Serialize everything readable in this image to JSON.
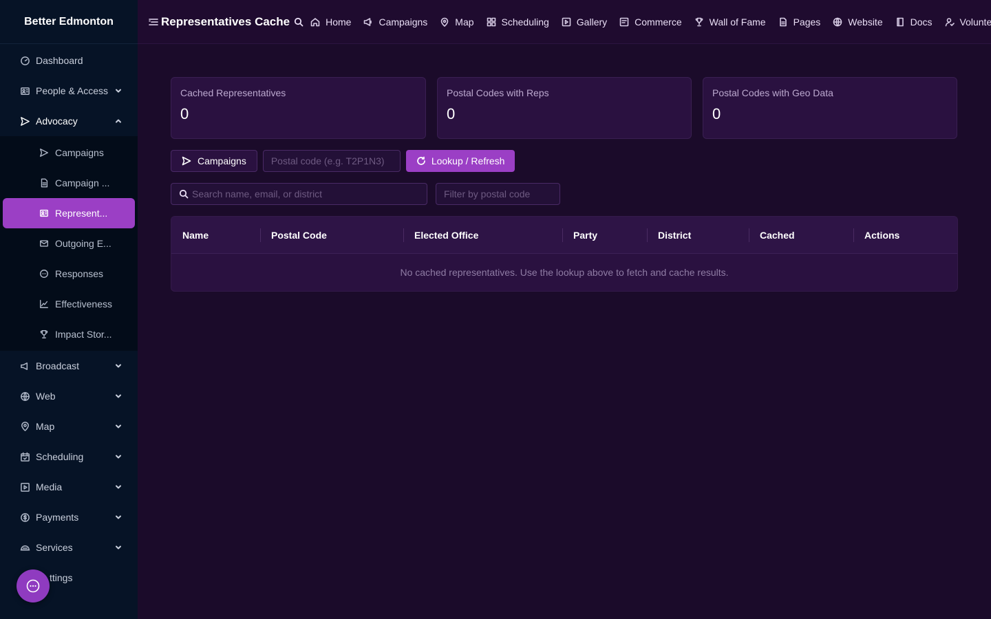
{
  "sidebar": {
    "brand": "Better Edmonton",
    "items_top": [
      {
        "label": "Dashboard",
        "icon": "dashboard-icon"
      },
      {
        "label": "People & Access",
        "icon": "people-icon"
      },
      {
        "label": "Advocacy",
        "icon": "send-icon"
      }
    ],
    "advocacy_sub": [
      {
        "label": "Campaigns",
        "icon": "send-icon"
      },
      {
        "label": "Campaign ...",
        "icon": "document-icon"
      },
      {
        "label": "Represent...",
        "icon": "id-card-icon"
      },
      {
        "label": "Outgoing E...",
        "icon": "mail-icon"
      },
      {
        "label": "Responses",
        "icon": "chat-icon"
      },
      {
        "label": "Effectiveness",
        "icon": "chart-icon"
      },
      {
        "label": "Impact Stor...",
        "icon": "trophy-icon"
      }
    ],
    "items_bottom": [
      {
        "label": "Broadcast",
        "icon": "megaphone-icon"
      },
      {
        "label": "Web",
        "icon": "globe-icon"
      },
      {
        "label": "Map",
        "icon": "map-pin-icon"
      },
      {
        "label": "Scheduling",
        "icon": "calendar-icon"
      },
      {
        "label": "Media",
        "icon": "play-icon"
      },
      {
        "label": "Payments",
        "icon": "dollar-icon"
      },
      {
        "label": "Services",
        "icon": "services-icon"
      },
      {
        "label": "ttings",
        "icon": "settings-icon"
      }
    ]
  },
  "topbar": {
    "title": "Representatives Cache",
    "links": [
      {
        "label": "Home",
        "icon": "home-icon"
      },
      {
        "label": "Campaigns",
        "icon": "megaphone-icon"
      },
      {
        "label": "Map",
        "icon": "map-pin-icon"
      },
      {
        "label": "Scheduling",
        "icon": "grid-icon"
      },
      {
        "label": "Gallery",
        "icon": "play-icon"
      },
      {
        "label": "Commerce",
        "icon": "commerce-icon"
      },
      {
        "label": "Wall of Fame",
        "icon": "trophy-icon"
      },
      {
        "label": "Pages",
        "icon": "document-icon"
      },
      {
        "label": "Website",
        "icon": "globe-icon"
      },
      {
        "label": "Docs",
        "icon": "book-icon"
      },
      {
        "label": "Volunteer",
        "icon": "volunteer-icon"
      }
    ]
  },
  "stats": [
    {
      "label": "Cached Representatives",
      "value": "0"
    },
    {
      "label": "Postal Codes with Reps",
      "value": "0"
    },
    {
      "label": "Postal Codes with Geo Data",
      "value": "0"
    }
  ],
  "toolbar": {
    "campaigns_label": "Campaigns",
    "postal_placeholder": "Postal code (e.g. T2P1N3)",
    "lookup_label": "Lookup / Refresh"
  },
  "filters": {
    "search_placeholder": "Search name, email, or district",
    "postal_filter_placeholder": "Filter by postal code"
  },
  "table": {
    "columns": [
      "Name",
      "Postal Code",
      "Elected Office",
      "Party",
      "District",
      "Cached",
      "Actions"
    ],
    "empty_message": "No cached representatives. Use the lookup above to fetch and cache results."
  },
  "colors": {
    "accent": "#9b3fc5",
    "sidebar_bg": "#061326",
    "main_bg": "#1b0b2a"
  }
}
